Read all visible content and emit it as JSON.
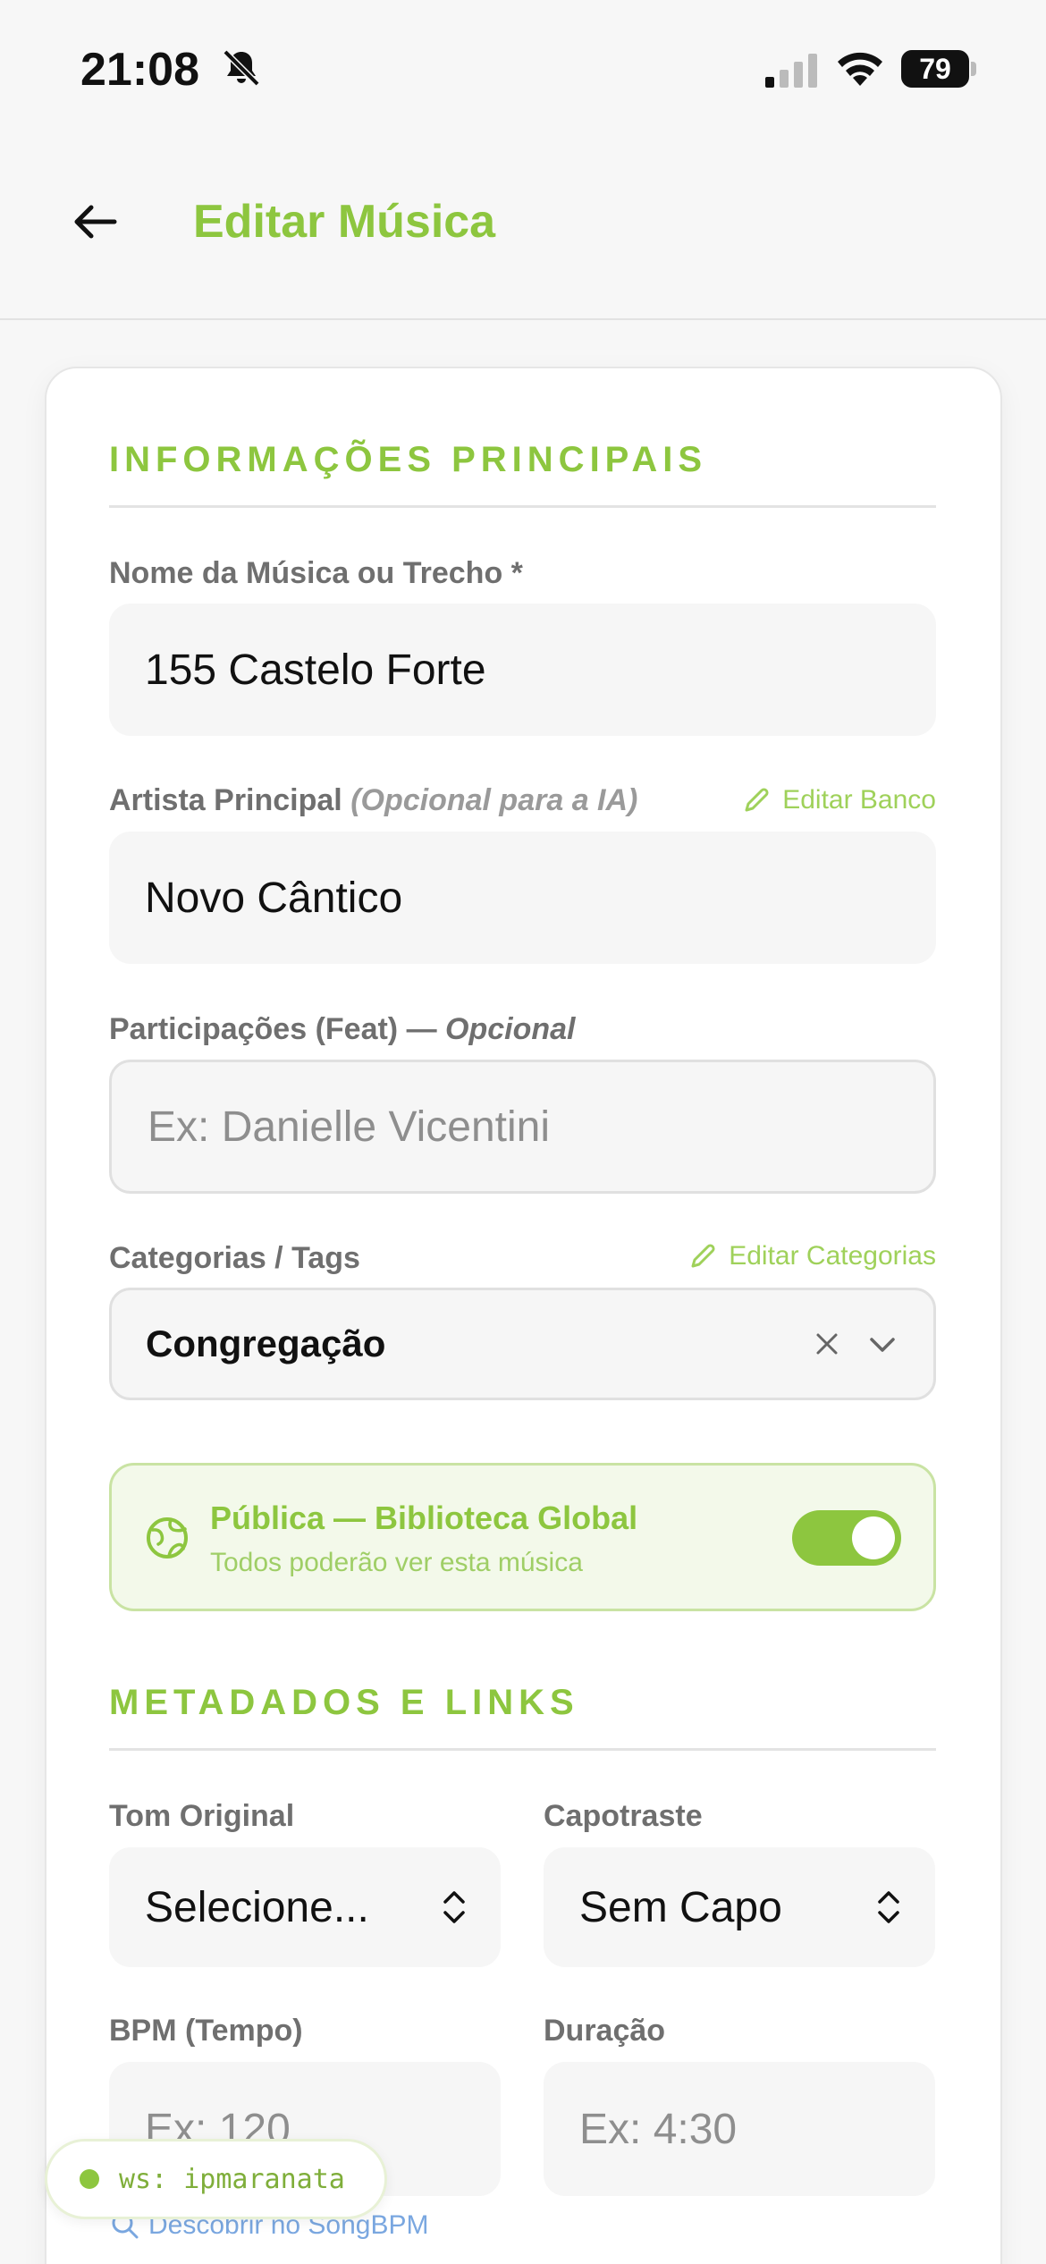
{
  "status_bar": {
    "time": "21:08",
    "battery": "79"
  },
  "header": {
    "title": "Editar Música"
  },
  "section_main": {
    "title": "INFORMAÇÕES PRINCIPAIS",
    "name_label": "Nome da Música ou Trecho *",
    "name_value": "155 Castelo Forte",
    "artist_label": "Artista Principal",
    "artist_optional": "(Opcional para a IA)",
    "artist_edit_link": "Editar Banco",
    "artist_value": "Novo Cântico",
    "feat_label": "Participações (Feat) —",
    "feat_optional": "Opcional",
    "feat_placeholder": "Ex: Danielle Vicentini",
    "tags_label": "Categorias / Tags",
    "tags_edit_link": "Editar Categorias",
    "tags_value": "Congregação"
  },
  "public": {
    "title": "Pública — Biblioteca Global",
    "subtitle": "Todos poderão ver esta música",
    "enabled": true
  },
  "section_meta": {
    "title": "METADADOS E LINKS",
    "key_label": "Tom Original",
    "key_value": "Selecione...",
    "capo_label": "Capotraste",
    "capo_value": "Sem Capo",
    "bpm_label": "BPM (Tempo)",
    "bpm_placeholder": "Ex: 120",
    "duration_label": "Duração",
    "duration_placeholder": "Ex: 4:30",
    "songbpm_link": "Descobrir no SongBPM"
  },
  "ws_badge": {
    "text": "ws: ipmaranata"
  },
  "colors": {
    "accent": "#8dc63f",
    "background": "#f7f7f7",
    "card": "#ffffff"
  }
}
